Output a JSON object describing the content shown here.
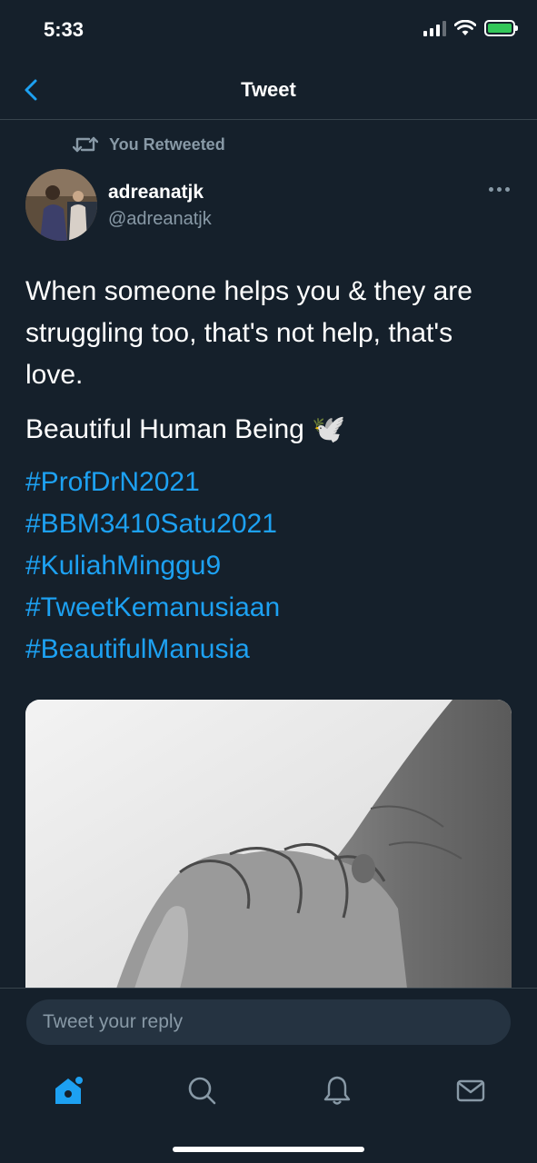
{
  "status": {
    "time": "5:33"
  },
  "nav": {
    "title": "Tweet"
  },
  "retweet": {
    "label": "You Retweeted"
  },
  "author": {
    "name": "adreanatjk",
    "handle": "@adreanatjk"
  },
  "tweet": {
    "text": "When someone helps you & they are struggling too, that's not help, that's love.",
    "text2": "Beautiful Human Being 🕊️",
    "hashtags": [
      "#ProfDrN2021",
      "#BBM3410Satu2021",
      "#KuliahMinggu9",
      "#TweetKemanusiaan",
      "#BeautifulManusia"
    ]
  },
  "reply": {
    "placeholder": "Tweet your reply"
  },
  "tabs": [
    {
      "icon": "home-icon",
      "active": true
    },
    {
      "icon": "search-icon",
      "active": false
    },
    {
      "icon": "bell-icon",
      "active": false
    },
    {
      "icon": "mail-icon",
      "active": false
    }
  ],
  "colors": {
    "background": "#15202b",
    "accent": "#1da1f2",
    "muted": "#8899a6",
    "divider": "#38444d",
    "battery": "#33c759"
  }
}
